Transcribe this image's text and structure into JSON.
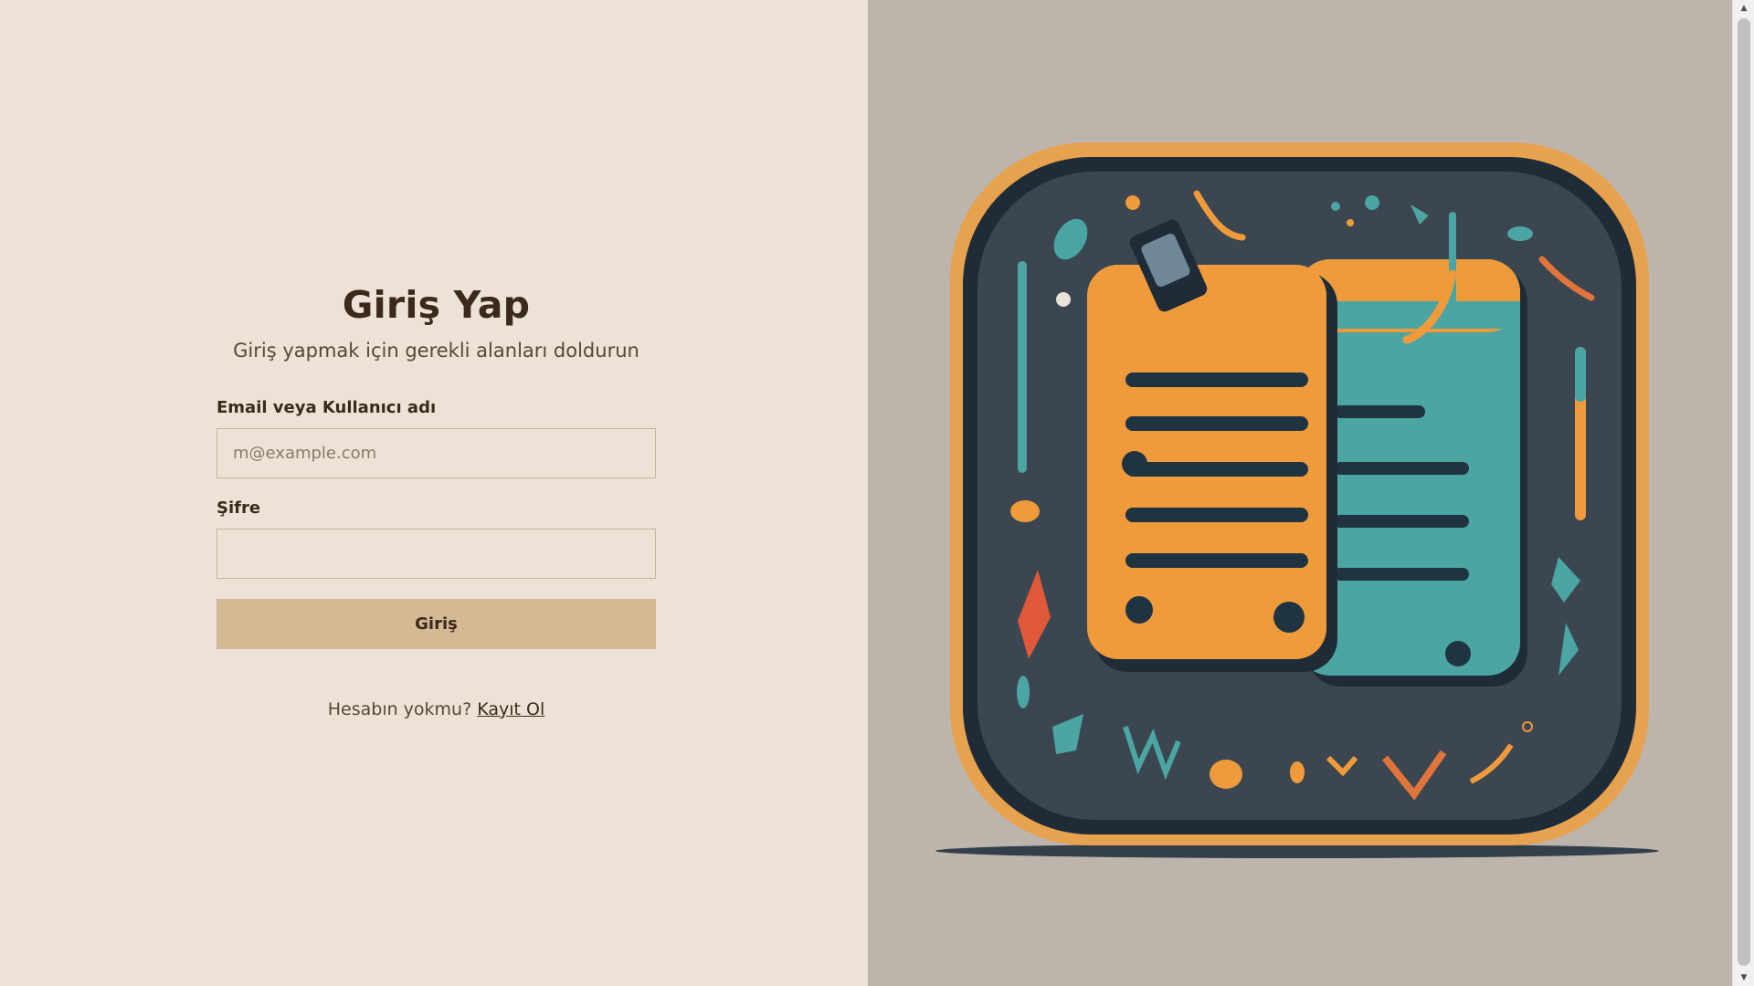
{
  "login": {
    "title": "Giriş Yap",
    "subtitle": "Giriş yapmak için gerekli alanları doldurun",
    "email_label": "Email veya Kullanıcı adı",
    "email_placeholder": "m@example.com",
    "email_value": "",
    "password_label": "Şifre",
    "password_value": "",
    "submit_label": "Giriş",
    "no_account_text": "Hesabın yokmu?",
    "signup_link_label": "Kayıt Ol"
  },
  "illustration": {
    "icon": "notepad-app-icon",
    "colors": {
      "frame": "#e6a24e",
      "board": "#3b4650",
      "note_orange": "#ef9b3c",
      "note_teal": "#4aa5a3",
      "background": "#bdb5ab"
    }
  },
  "theme": {
    "left_background": "#ece3d6",
    "button_background": "#d4b995",
    "text_color": "#3b2a1c"
  },
  "scrollbar": {
    "up_icon": "scroll-up-arrow-icon",
    "down_icon": "scroll-down-arrow-icon"
  }
}
